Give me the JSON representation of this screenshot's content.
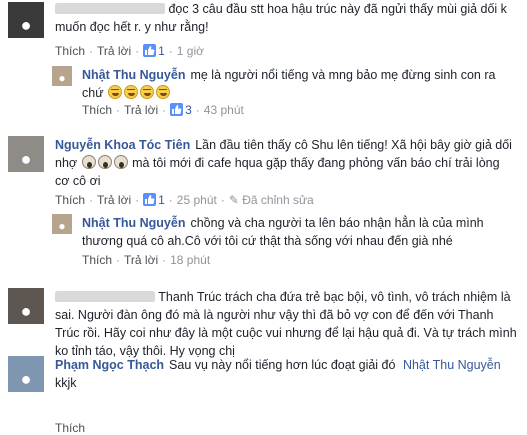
{
  "comments": [
    {
      "name": "",
      "text": "đọc 3 câu đầu stt hoa hậu trúc này đã ngửi thấy mùi giả dối k muốn đọc hết r. y như rằng!",
      "actions": {
        "like": "Thích",
        "reply": "Trả lời",
        "likes": "1",
        "time": "1 giờ",
        "edited": ""
      }
    },
    {
      "name": "Nhật Thu Nguyễn",
      "text": "mẹ là người nổi tiếng và mng bảo mẹ đừng sinh con ra chứ",
      "actions": {
        "like": "Thích",
        "reply": "Trả lời",
        "likes": "3",
        "time": "43 phút",
        "edited": ""
      }
    },
    {
      "name": "Nguyễn Khoa Tóc Tiên",
      "text_a": "Lần đầu tiên thấy cô Shu lên tiếng! Xã hội bây giờ giả dối nhợ",
      "text_b": "mà tôi mới đi cafe hqua gặp thấy đang phỏng vấn báo chí trải lòng cơ cô ơi",
      "actions": {
        "like": "Thích",
        "reply": "Trả lời",
        "likes": "1",
        "time": "25 phút",
        "edited": "Đã chỉnh sửa"
      }
    },
    {
      "name": "Nhật Thu Nguyễn",
      "text": "chồng và cha người ta lên báo nhận hẳn là của mình thương quá cô ah.Cô với tôi cứ thật thà sống với nhau đến già nhé",
      "actions": {
        "like": "Thích",
        "reply": "Trả lời",
        "likes": "",
        "time": "18 phút",
        "edited": ""
      }
    },
    {
      "name": "",
      "text": "Thanh Trúc trách cha đứa trẻ bạc bội, vô tình, vô trách nhiệm là sai. Người đàn ông đó mà là người như vậy thì đã bỏ vợ con để đến với Thanh Trúc rồi. Hãy coi như đây là một cuộc vui nhưng để lại hậu quả đi. Và tự trách mình ko tỉnh táo, vậy thôi. Hy vọng chị",
      "actions": {
        "like": "",
        "reply": "",
        "likes": "",
        "time": "",
        "edited": ""
      }
    },
    {
      "name": "Phạm Ngọc Thạch",
      "text": "Sau vụ này nổi tiếng hơn lúc đoạt giải đó",
      "tag": "Nhật Thu Nguyễn",
      "text2": "kkjk",
      "actions": {
        "like": "Thích",
        "reply": "",
        "likes": "",
        "time": "",
        "edited": ""
      }
    }
  ],
  "icons": {
    "like": "thumbs-up-icon",
    "edit": "edited-pencil-icon",
    "laugh": "laughing-emoji-icon",
    "scream": "screaming-emoji-icon"
  }
}
